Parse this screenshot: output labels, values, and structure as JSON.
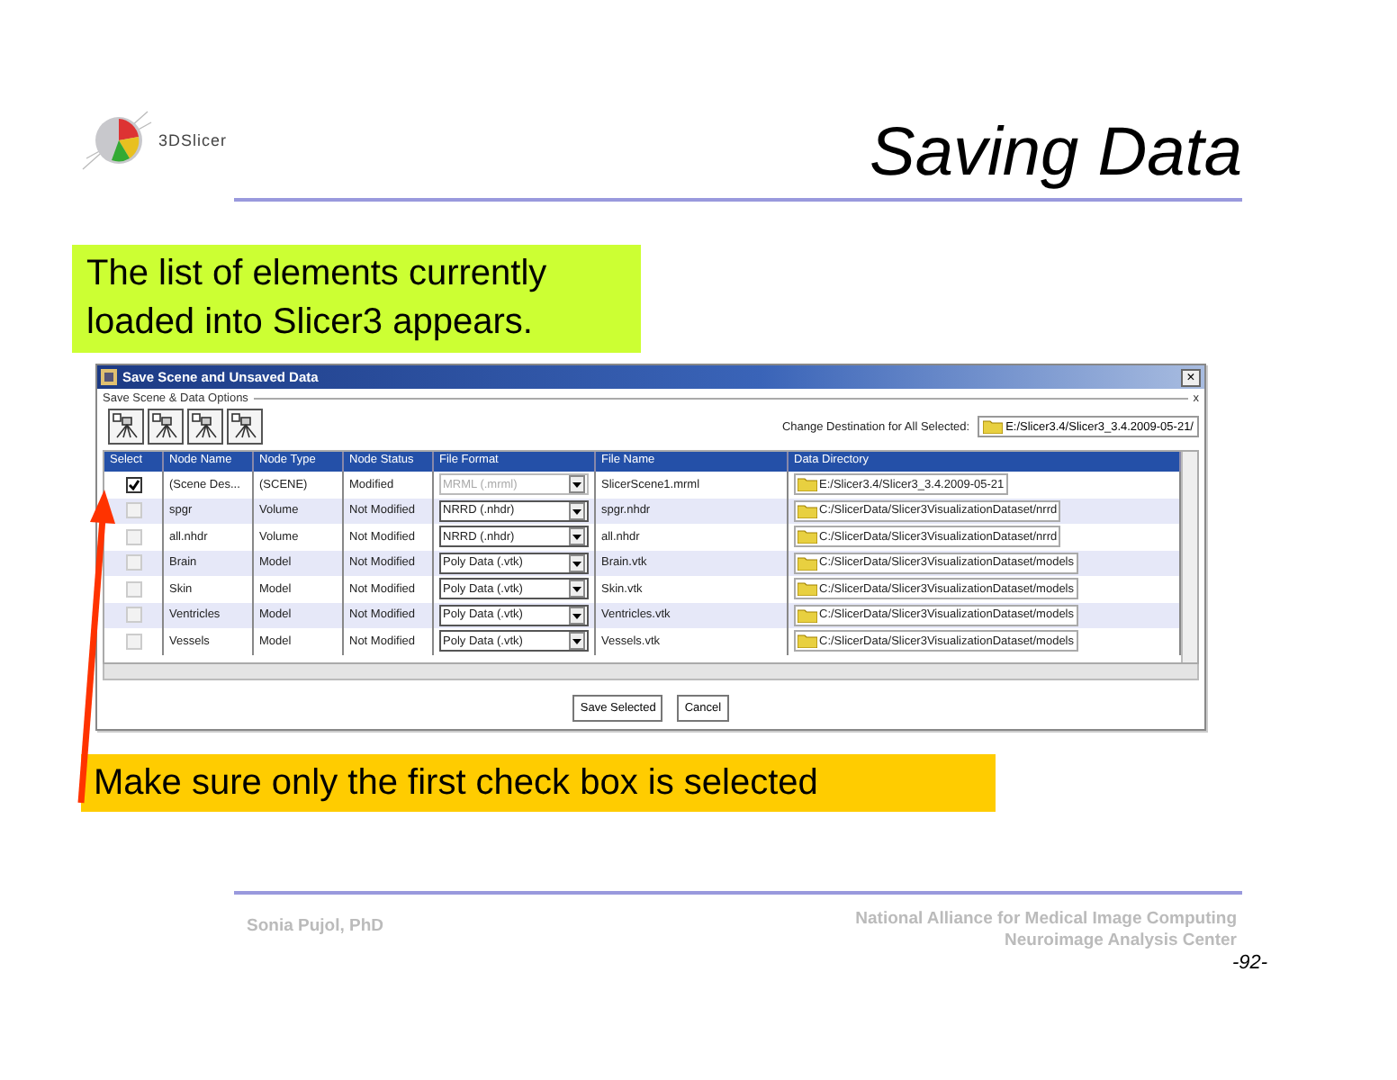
{
  "logo": {
    "text": "3DSlicer"
  },
  "title": "Saving Data",
  "callout_top": "The list of elements currently loaded into Slicer3 appears.",
  "dialog": {
    "title": "Save Scene and Unsaved Data",
    "close": "×",
    "group_label": "Save Scene & Data Options",
    "group_close": "x",
    "destination_label": "Change Destination for All Selected:",
    "destination_value": "E:/Slicer3.4/Slicer3_3.4.2009-05-21/",
    "columns": [
      "Select",
      "Node Name",
      "Node Type",
      "Node Status",
      "File Format",
      "File Name",
      "Data Directory"
    ],
    "rows": [
      {
        "checked": true,
        "node_name": "(Scene Des...",
        "node_type": "(SCENE)",
        "node_status": "Modified",
        "file_format": "MRML (.mrml)",
        "format_disabled": true,
        "file_name": "SlicerScene1.mrml",
        "data_directory": "E:/Slicer3.4/Slicer3_3.4.2009-05-21"
      },
      {
        "checked": false,
        "node_name": "spgr",
        "node_type": "Volume",
        "node_status": "Not Modified",
        "file_format": "NRRD (.nhdr)",
        "format_disabled": false,
        "file_name": "spgr.nhdr",
        "data_directory": "C:/SlicerData/Slicer3VisualizationDataset/nrrd"
      },
      {
        "checked": false,
        "node_name": "all.nhdr",
        "node_type": "Volume",
        "node_status": "Not Modified",
        "file_format": "NRRD (.nhdr)",
        "format_disabled": false,
        "file_name": "all.nhdr",
        "data_directory": "C:/SlicerData/Slicer3VisualizationDataset/nrrd"
      },
      {
        "checked": false,
        "node_name": "Brain",
        "node_type": "Model",
        "node_status": "Not Modified",
        "file_format": "Poly Data (.vtk)",
        "format_disabled": false,
        "file_name": "Brain.vtk",
        "data_directory": "C:/SlicerData/Slicer3VisualizationDataset/models"
      },
      {
        "checked": false,
        "node_name": "Skin",
        "node_type": "Model",
        "node_status": "Not Modified",
        "file_format": "Poly Data (.vtk)",
        "format_disabled": false,
        "file_name": "Skin.vtk",
        "data_directory": "C:/SlicerData/Slicer3VisualizationDataset/models"
      },
      {
        "checked": false,
        "node_name": "Ventricles",
        "node_type": "Model",
        "node_status": "Not Modified",
        "file_format": "Poly Data (.vtk)",
        "format_disabled": false,
        "file_name": "Ventricles.vtk",
        "data_directory": "C:/SlicerData/Slicer3VisualizationDataset/models"
      },
      {
        "checked": false,
        "node_name": "Vessels",
        "node_type": "Model",
        "node_status": "Not Modified",
        "file_format": "Poly Data (.vtk)",
        "format_disabled": false,
        "file_name": "Vessels.vtk",
        "data_directory": "C:/SlicerData/Slicer3VisualizationDataset/models"
      }
    ],
    "buttons": [
      "Save Selected",
      "Cancel"
    ]
  },
  "callout_bottom": "Make sure only the first check box is selected",
  "footer": {
    "author": "Sonia Pujol, PhD",
    "org_lines": [
      "National Alliance for Medical Image Computing",
      "Neuroimage Analysis Center"
    ]
  },
  "page_number": "-92-"
}
